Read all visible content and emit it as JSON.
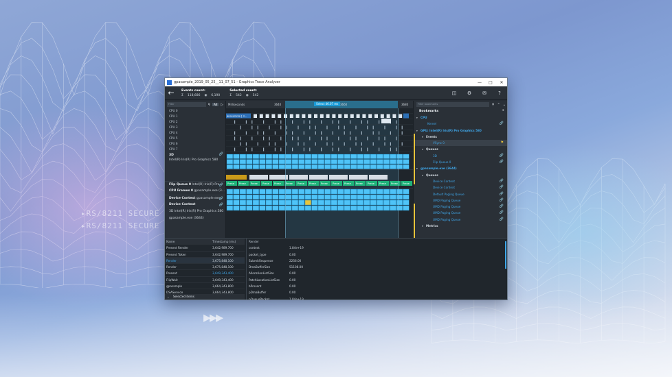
{
  "window_title": "gpasample_2019_05_25__11_07_51 - Graphics Trace Analyzer",
  "toolbar": {
    "events_label": "Events count:",
    "events_total": "118,686",
    "events_visible": "6,190",
    "selected_label": "Selected count:",
    "selected_total": "542",
    "selected_visible": "542"
  },
  "left_search_placeholder": "Filter",
  "all_label": "All",
  "cpus": [
    "CPU 0",
    "CPU 1",
    "CPU 2",
    "CPU 3",
    "CPU 4",
    "CPU 5",
    "CPU 6",
    "CPU 7"
  ],
  "tracks": {
    "t3d_title": "3D",
    "t3d_sub": "Intel(R) Iris(R) Pro Graphics 580",
    "flip_title": "Flip Queue 0",
    "flip_sub": "Intel(R) Iris(R) Pro",
    "cpu_frames_title": "CPU Frames 0",
    "cpu_frames_sub": "gpasample.exe (3...",
    "dc1_title": "Device Context",
    "dc1_sub": "gpasample.exe",
    "dc2_title": "Device Context",
    "dc2_sub": "3D Intel(R) Iris(R) Pro Graphics 580",
    "dc2_sub2": "gpasample.exe (3644)"
  },
  "ruler": {
    "unit": "Milliseconds",
    "tick1": "3640",
    "tick2": "3660",
    "tick3": "3680",
    "selection": "Select 46.07 ms"
  },
  "timeline": {
    "cpu_label": "gpasample [ 3...",
    "frame_label": "Prese",
    "bar_label": "Preset"
  },
  "bookmarks": {
    "search_placeholder": "Filter bookmarks",
    "title": "Bookmarks",
    "items": [
      {
        "label": "CPU",
        "type": "head",
        "depth": 0
      },
      {
        "label": "Kernel",
        "type": "item",
        "depth": 2,
        "link": true
      },
      {
        "label": "GPU: Intel(R) Iris(R) Pro Graphics 580",
        "type": "head",
        "depth": 0
      },
      {
        "label": "Events",
        "type": "sub",
        "depth": 1
      },
      {
        "label": "VSync 0",
        "type": "item",
        "depth": 3,
        "flag": true,
        "sel": true
      },
      {
        "label": "Queues",
        "type": "sub",
        "depth": 1
      },
      {
        "label": "3D",
        "type": "item",
        "depth": 3,
        "link": true
      },
      {
        "label": "Flip Queue 0",
        "type": "item",
        "depth": 3,
        "link": true
      },
      {
        "label": "gpasample.exe (3644)",
        "type": "head",
        "depth": 0
      },
      {
        "label": "Queues",
        "type": "sub",
        "depth": 1
      },
      {
        "label": "Device Context",
        "type": "item",
        "depth": 3,
        "link": true
      },
      {
        "label": "Device Context",
        "type": "item",
        "depth": 3,
        "link": true
      },
      {
        "label": "Default Paging Queue",
        "type": "item",
        "depth": 3,
        "link": true
      },
      {
        "label": "UMD Paging Queue",
        "type": "item",
        "depth": 3,
        "link": true
      },
      {
        "label": "UMD Paging Queue",
        "type": "item",
        "depth": 3,
        "link": true
      },
      {
        "label": "UMD Paging Queue",
        "type": "item",
        "depth": 3,
        "link": true
      },
      {
        "label": "UMD Paging Queue",
        "type": "item",
        "depth": 3,
        "link": true
      },
      {
        "label": "Metrics",
        "type": "sub",
        "depth": 1
      }
    ]
  },
  "events_table": {
    "headers": [
      "Name",
      "Timestamp (ms)"
    ],
    "rows": [
      {
        "name": "Present Render",
        "ts": "3,642,989,700"
      },
      {
        "name": "Present Token",
        "ts": "3,642,989,700"
      },
      {
        "name": "Render",
        "ts": "3,675,848,100",
        "sel": true
      },
      {
        "name": "Render",
        "ts": "3,675,848,100"
      },
      {
        "name": "Present",
        "ts": "3,649,343,400",
        "blue": true
      },
      {
        "name": "FlipWait",
        "ts": "3,649,343,400"
      },
      {
        "name": "gpasample",
        "ts": "3,664,343,800"
      },
      {
        "name": "DSAService",
        "ts": "3,664,343,800"
      }
    ]
  },
  "properties": {
    "title": "Render",
    "rows": [
      {
        "k": "context",
        "v": "1.84e+19"
      },
      {
        "k": "packet_type",
        "v": "0.00"
      },
      {
        "k": "SubmitSequence",
        "v": "2256.00"
      },
      {
        "k": "DmaBufferSize",
        "v": "51108.00"
      },
      {
        "k": "AllocationListSize",
        "v": "0.00"
      },
      {
        "k": "PatchLocationListSize",
        "v": "0.00"
      },
      {
        "k": "bPresent",
        "v": "0.00"
      },
      {
        "k": "pDmaBuffer",
        "v": "0.00"
      },
      {
        "k": "pQueuePacket",
        "v": "1.84e+19"
      }
    ]
  },
  "selected_items_label": "Selected items",
  "background": {
    "code_line1": "▸RS/8211 SECURE",
    "code_line2": "▸RS/8211 SECURE",
    "arrows": "▸▸▸"
  },
  "colors": {
    "accent": "#3fa6e8",
    "bar": "#4fc3f7",
    "frame": "#1fb37a",
    "flag": "#e8c43a"
  }
}
